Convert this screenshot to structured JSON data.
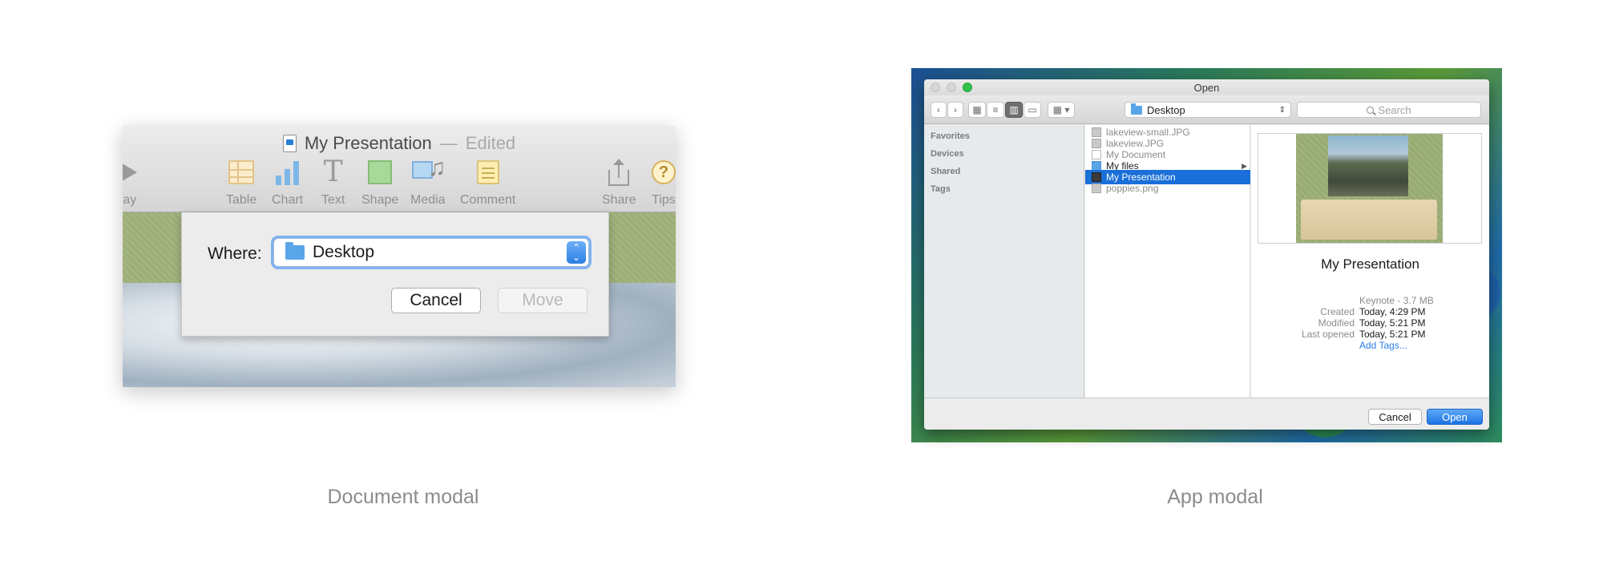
{
  "document_modal": {
    "window_title": "My Presentation",
    "title_separator": "—",
    "title_status": "Edited",
    "toolbar": [
      {
        "label": "lay",
        "icon": "play-icon"
      },
      {
        "label": "Table",
        "icon": "table-icon"
      },
      {
        "label": "Chart",
        "icon": "chart-icon"
      },
      {
        "label": "Text",
        "icon": "text-icon"
      },
      {
        "label": "Shape",
        "icon": "shape-icon"
      },
      {
        "label": "Media",
        "icon": "media-icon"
      },
      {
        "label": "Comment",
        "icon": "comment-icon"
      },
      {
        "label": "Share",
        "icon": "share-icon"
      },
      {
        "label": "Tips",
        "icon": "tips-icon"
      }
    ],
    "where_label": "Where:",
    "where_value": "Desktop",
    "cancel_label": "Cancel",
    "move_label": "Move",
    "caption": "Document modal"
  },
  "app_modal": {
    "window_title": "Open",
    "path_value": "Desktop",
    "search_placeholder": "Search",
    "sidebar": [
      "Favorites",
      "Devices",
      "Shared",
      "Tags"
    ],
    "files": [
      {
        "name": "lakeview-small.JPG",
        "kind": "image"
      },
      {
        "name": "lakeview.JPG",
        "kind": "image"
      },
      {
        "name": "My Document",
        "kind": "document"
      },
      {
        "name": "My files",
        "kind": "folder"
      },
      {
        "name": "My Presentation",
        "kind": "keynote",
        "selected": true
      },
      {
        "name": "poppies.png",
        "kind": "image"
      }
    ],
    "preview": {
      "name": "My Presentation",
      "kind": "Keynote - 3.7 MB",
      "created_label": "Created",
      "created_value": "Today, 4:29 PM",
      "modified_label": "Modified",
      "modified_value": "Today, 5:21 PM",
      "last_opened_label": "Last opened",
      "last_opened_value": "Today, 5:21 PM",
      "add_tags": "Add Tags..."
    },
    "cancel_label": "Cancel",
    "open_label": "Open",
    "caption": "App modal",
    "colors": {
      "accent": "#1a6fd8",
      "open_button": "#2b7fe4"
    }
  }
}
